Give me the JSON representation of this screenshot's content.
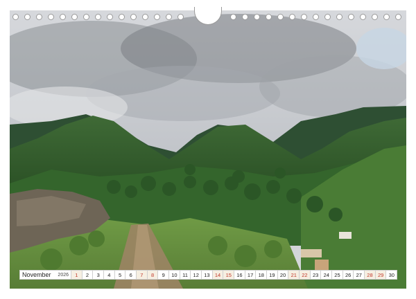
{
  "calendar": {
    "month": "November",
    "year": "2026",
    "weekend_color": "#c0392b",
    "days": [
      {
        "n": "1",
        "weekend": true
      },
      {
        "n": "2",
        "weekend": false
      },
      {
        "n": "3",
        "weekend": false
      },
      {
        "n": "4",
        "weekend": false
      },
      {
        "n": "5",
        "weekend": false
      },
      {
        "n": "6",
        "weekend": false
      },
      {
        "n": "7",
        "weekend": true
      },
      {
        "n": "8",
        "weekend": true
      },
      {
        "n": "9",
        "weekend": false
      },
      {
        "n": "10",
        "weekend": false
      },
      {
        "n": "11",
        "weekend": false
      },
      {
        "n": "12",
        "weekend": false
      },
      {
        "n": "13",
        "weekend": false
      },
      {
        "n": "14",
        "weekend": true
      },
      {
        "n": "15",
        "weekend": true
      },
      {
        "n": "16",
        "weekend": false
      },
      {
        "n": "17",
        "weekend": false
      },
      {
        "n": "18",
        "weekend": false
      },
      {
        "n": "19",
        "weekend": false
      },
      {
        "n": "20",
        "weekend": false
      },
      {
        "n": "21",
        "weekend": true
      },
      {
        "n": "22",
        "weekend": true
      },
      {
        "n": "23",
        "weekend": false
      },
      {
        "n": "24",
        "weekend": false
      },
      {
        "n": "25",
        "weekend": false
      },
      {
        "n": "26",
        "weekend": false
      },
      {
        "n": "27",
        "weekend": false
      },
      {
        "n": "28",
        "weekend": true
      },
      {
        "n": "29",
        "weekend": true
      },
      {
        "n": "30",
        "weekend": false
      }
    ]
  },
  "photo": {
    "subject": "mountain-valley-landscape",
    "colors": {
      "sky": "#c9ccd0",
      "cloud_dark": "#7c8085",
      "forest": "#2f5a2a",
      "meadow": "#7fa24e",
      "path": "#a48a6a"
    }
  }
}
